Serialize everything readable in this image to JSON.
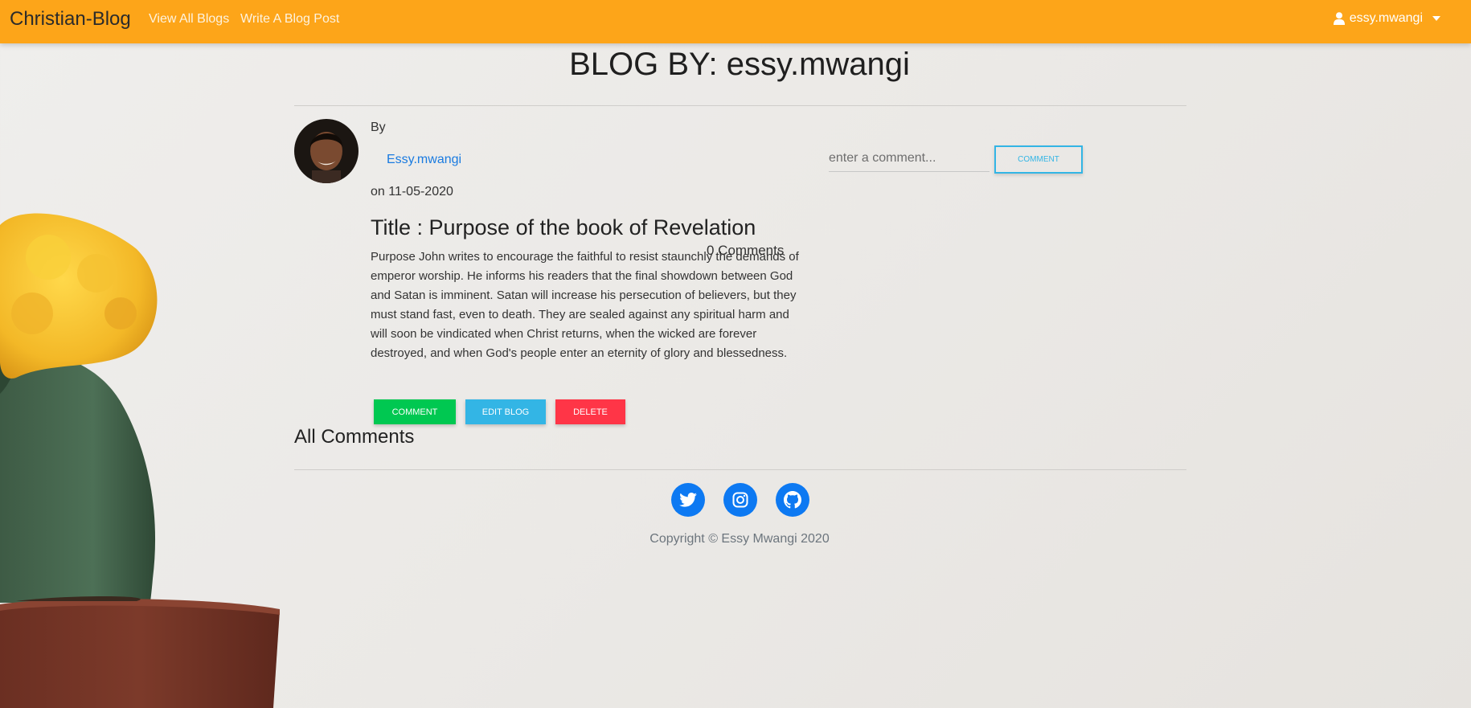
{
  "navbar": {
    "brand": "Christian-Blog",
    "links": [
      "View All Blogs",
      "Write A Blog Post"
    ],
    "user": "essy.mwangi"
  },
  "page": {
    "heading": "BLOG BY: essy.mwangi"
  },
  "post": {
    "by_label": "By",
    "author": "Essy.mwangi",
    "date": "on 11-05-2020",
    "title": "Title : Purpose of the book of Revelation",
    "comment_count": "0 Comments",
    "body": "Purpose John writes to encourage the faithful to resist staunchly the demands of emperor worship. He informs his readers that the final showdown between God and Satan is imminent. Satan will increase his persecution of believers, but they must stand fast, even to death. They are sealed against any spiritual harm and will soon be vindicated when Christ returns, when the wicked are forever destroyed, and when God's people enter an eternity of glory and blessedness."
  },
  "actions": {
    "comment": "COMMENT",
    "edit": "EDIT BLOG",
    "delete": "DELETE"
  },
  "comment_form": {
    "placeholder": "enter a comment...",
    "button": "COMMENT"
  },
  "comments_section": {
    "heading": "All Comments"
  },
  "footer": {
    "social": [
      "twitter-icon",
      "instagram-icon",
      "github-icon"
    ],
    "copyright": "Copyright © Essy Mwangi 2020"
  },
  "colors": {
    "navbar": "#fda519",
    "comment_button": "#00c851",
    "edit_button": "#33b5e5",
    "delete_button": "#ff3547",
    "social": "#0d79f2"
  }
}
